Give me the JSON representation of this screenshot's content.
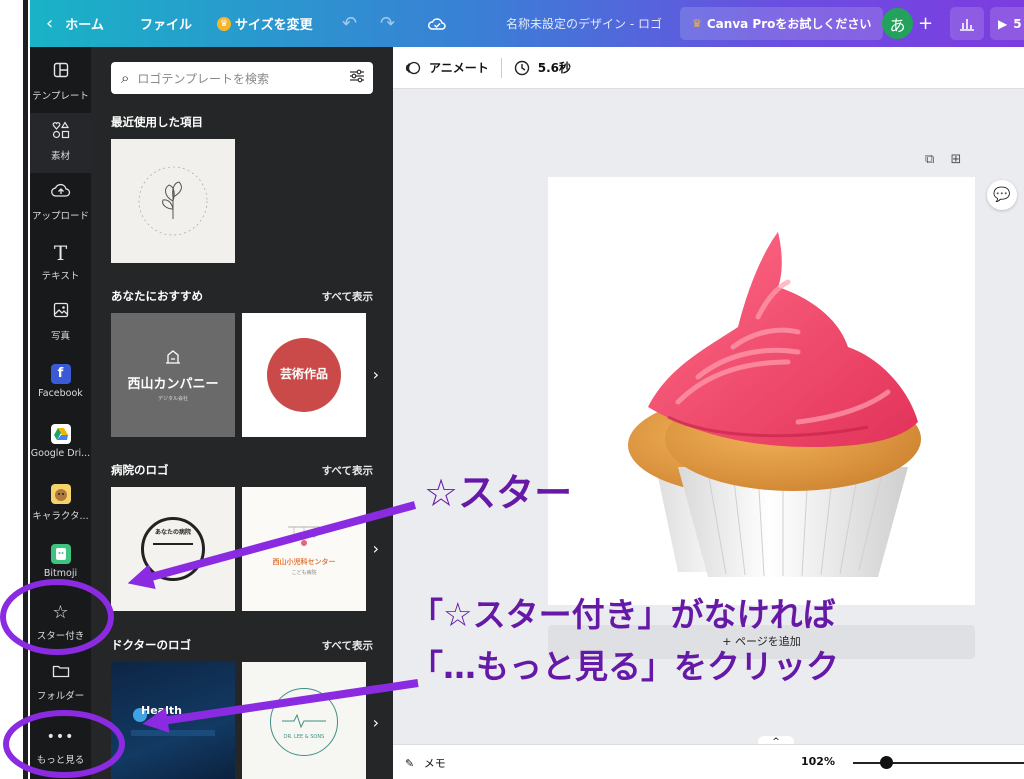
{
  "topbar": {
    "home": "ホーム",
    "file": "ファイル",
    "resize": "サイズを変更",
    "title": "名称未設定のデザイン - ロゴ",
    "pro": "Canva Proをお試しください",
    "avatar": "あ",
    "present_prefix": "5"
  },
  "rail": {
    "items": [
      {
        "label": "テンプレート",
        "icon": "template-icon"
      },
      {
        "label": "素材",
        "icon": "elements-icon"
      },
      {
        "label": "アップロード",
        "icon": "upload-icon"
      },
      {
        "label": "テキスト",
        "icon": "text-icon"
      },
      {
        "label": "写真",
        "icon": "photo-icon"
      },
      {
        "label": "Facebook",
        "icon": "facebook-icon"
      },
      {
        "label": "Google Dri...",
        "icon": "google-drive-icon"
      },
      {
        "label": "キャラクタ...",
        "icon": "character-icon"
      },
      {
        "label": "Bitmoji",
        "icon": "bitmoji-icon"
      },
      {
        "label": "スター付き",
        "icon": "star-icon"
      },
      {
        "label": "フォルダー",
        "icon": "folder-icon"
      },
      {
        "label": "もっと見る",
        "icon": "more-icon"
      }
    ]
  },
  "panel": {
    "search_placeholder": "ロゴテンプレートを検索",
    "recent_title": "最近使用した項目",
    "recommend_title": "あなたにおすすめ",
    "hospital_title": "病院のロゴ",
    "doctor_title": "ドクターのロゴ",
    "see_all": "すべて表示",
    "thumbs": {
      "rec1_title": "西山カンパニー",
      "rec1_sub": "デジタル会社",
      "rec2_title": "芸術作品",
      "hosp1_text": "あなたの病院",
      "hosp2_title": "西山小児科センター",
      "hosp2_sub": "こども病院",
      "doc1_text": "Health",
      "doc2_title": "DR. LEE & SONS"
    }
  },
  "editor": {
    "animate": "アニメート",
    "duration": "5.6秒",
    "add_page": "+ ページを追加",
    "memo": "メモ",
    "zoom": "102%"
  },
  "annotations": {
    "star": "☆スター",
    "line1": "「☆スター付き」がなければ",
    "line2": "「…もっと見る」をクリック"
  },
  "colors": {
    "annotation": "#7a1fc4",
    "rail_bg": "#18191b",
    "panel_bg": "#252627",
    "frosting": "#f0476a",
    "cake": "#e79a3c"
  }
}
